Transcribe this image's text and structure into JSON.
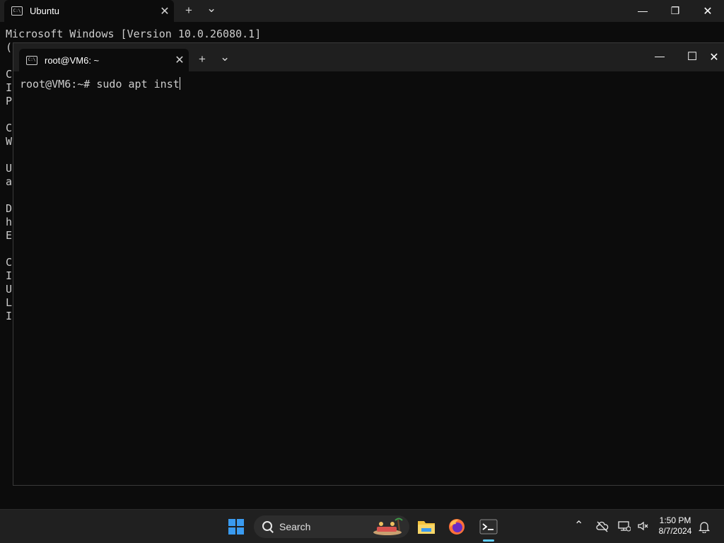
{
  "back_window": {
    "tab_title": "Ubuntu",
    "tab_icon_text": "C:\\",
    "close_symbol": "✕",
    "new_tab_symbol": "+",
    "dropdown_symbol": "⌄",
    "minimize_symbol": "—",
    "restore_symbol": "❐",
    "window_close_symbol": "✕",
    "output_lines": [
      "Microsoft Windows [Version 10.0.26080.1]",
      "(",
      "",
      "C",
      "I",
      "P",
      "",
      "C",
      "W",
      "",
      "U",
      "a",
      "",
      "D",
      "h",
      "E",
      "",
      "C",
      "I",
      "U",
      "L",
      "I"
    ]
  },
  "front_window": {
    "tab_title": "root@VM6: ~",
    "tab_icon_text": "C:\\",
    "close_symbol": "✕",
    "new_tab_symbol": "+",
    "dropdown_symbol": "⌄",
    "minimize_symbol": "—",
    "maximize_symbol": "☐",
    "window_close_symbol": "✕",
    "prompt": "root@VM6:~# ",
    "command": "sudo apt inst"
  },
  "taskbar": {
    "search_placeholder": "Search",
    "icons": [
      "windows-start-icon",
      "search-icon",
      "file-explorer-icon",
      "firefox-icon",
      "terminal-icon"
    ],
    "tray": {
      "chevron": "⌃",
      "time": "1:50 PM",
      "date": "8/7/2024"
    },
    "colors": {
      "start_blue": "#3a9bf0",
      "folder_yellow": "#f3c33d",
      "accent": "#60cdff"
    }
  }
}
